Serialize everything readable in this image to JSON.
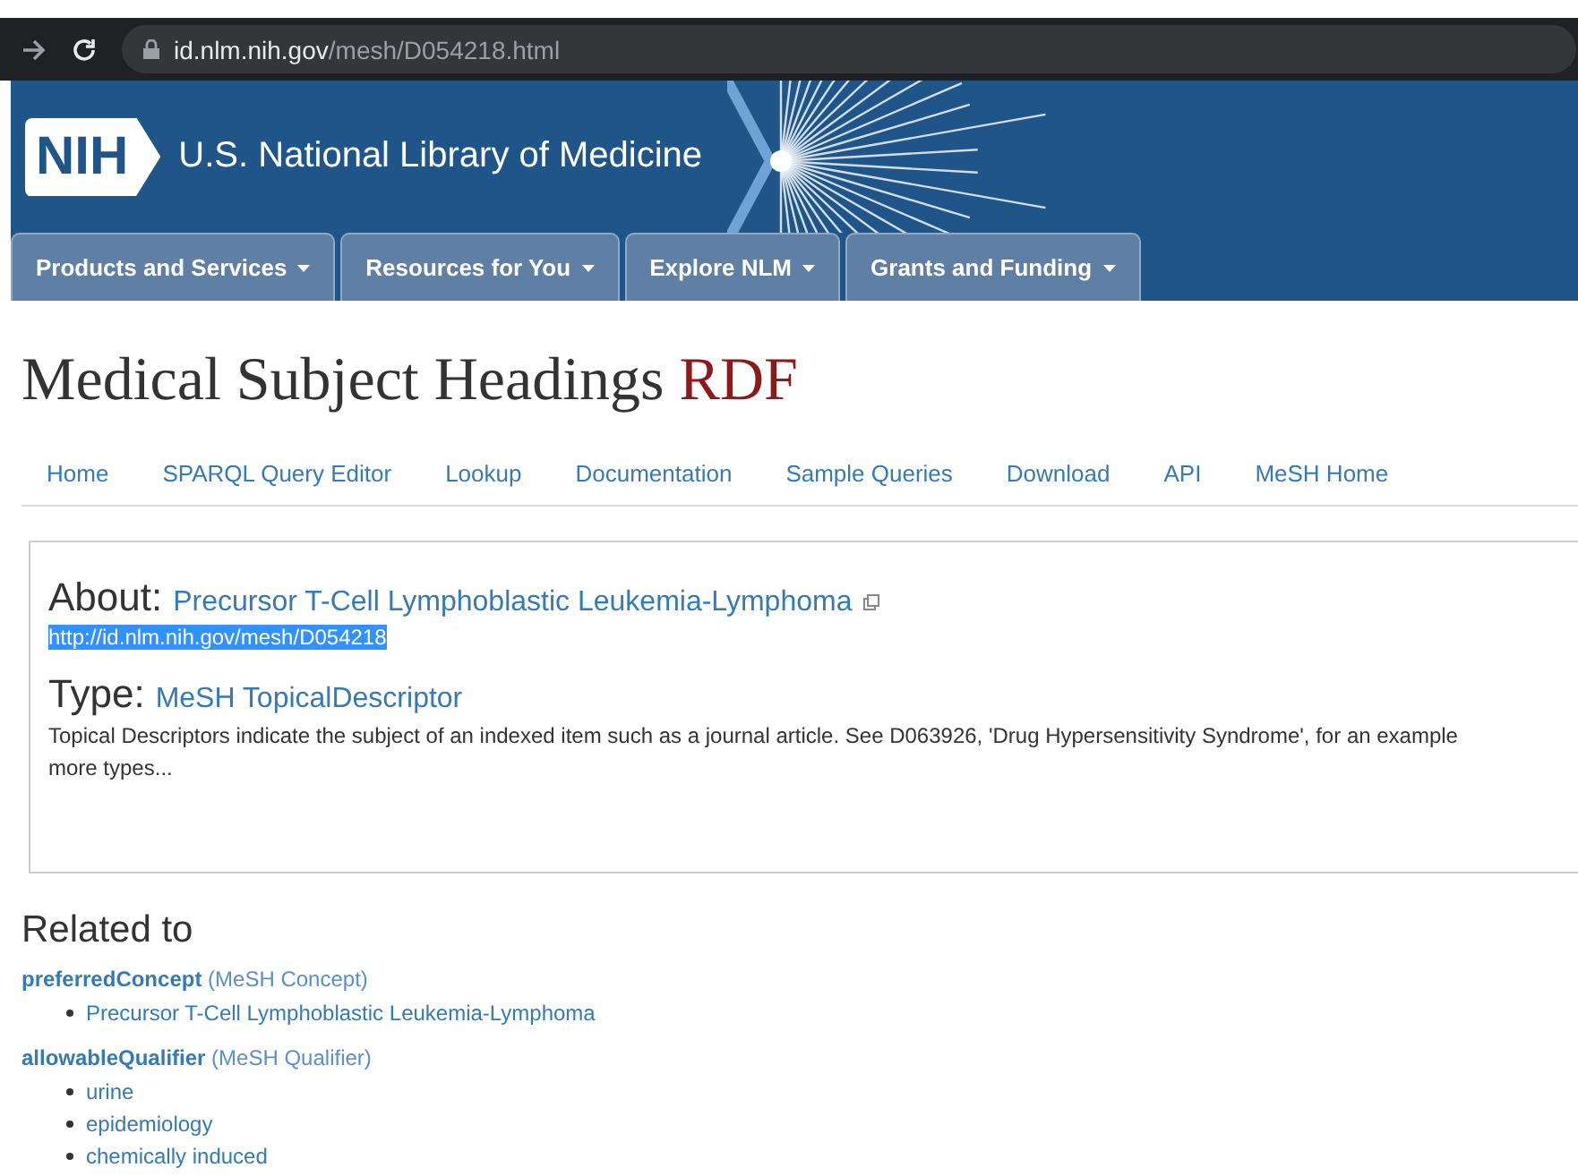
{
  "browser": {
    "url_host": "id.nlm.nih.gov",
    "url_path": "/mesh/D054218.html"
  },
  "banner": {
    "logo": "NIH",
    "title": "U.S. National Library of Medicine"
  },
  "tabs": [
    {
      "label": "Products and Services",
      "selected": false
    },
    {
      "label": "Resources for You",
      "selected": false
    },
    {
      "label": "Explore NLM",
      "selected": false
    },
    {
      "label": "Grants and Funding",
      "selected": false
    }
  ],
  "page_title": {
    "main": "Medical Subject Headings",
    "accent": "RDF"
  },
  "nav": [
    "Home",
    "SPARQL Query Editor",
    "Lookup",
    "Documentation",
    "Sample Queries",
    "Download",
    "API",
    "MeSH Home"
  ],
  "about": {
    "label": "About:",
    "name": "Precursor T-Cell Lymphoblastic Leukemia-Lymphoma",
    "uri": "http://id.nlm.nih.gov/mesh/D054218",
    "uri_selected": true,
    "type_label": "Type:",
    "type": "MeSH TopicalDescriptor",
    "description": "Topical Descriptors indicate the subject of an indexed item such as a journal article. See D063926, 'Drug Hypersensitivity Syndrome', for an example",
    "more": "more types..."
  },
  "related": {
    "heading": "Related to",
    "groups": [
      {
        "property": "preferredConcept",
        "type": "(MeSH Concept)",
        "items": [
          "Precursor T-Cell Lymphoblastic Leukemia-Lymphoma"
        ]
      },
      {
        "property": "allowableQualifier",
        "type": "(MeSH Qualifier)",
        "items": [
          "urine",
          "epidemiology",
          "chemically induced"
        ]
      }
    ]
  }
}
